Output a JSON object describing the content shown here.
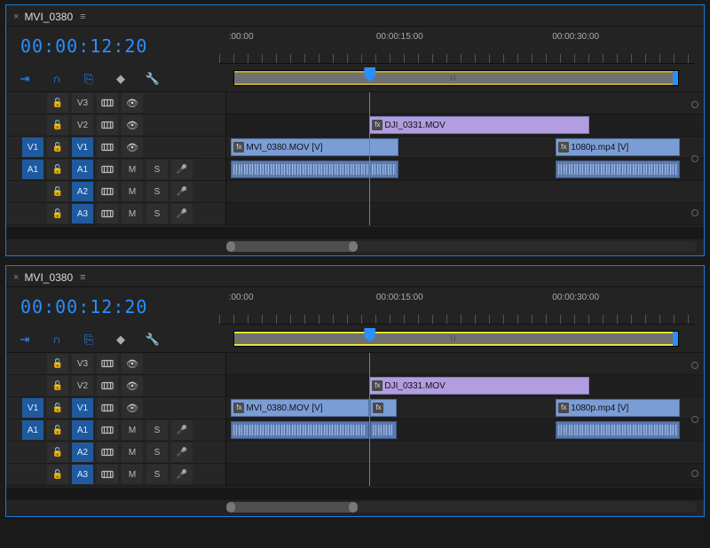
{
  "panels": [
    {
      "tab": "MVI_0380",
      "timecode": "00:00:12:20",
      "ruler_ticks": [
        ":00:00",
        "00:00:15:00",
        "00:00:30:00"
      ],
      "tracks": {
        "video": [
          {
            "name": "V3"
          },
          {
            "name": "V2"
          },
          {
            "name": "V1",
            "src": "V1"
          }
        ],
        "audio": [
          {
            "name": "A1",
            "src": "A1",
            "mute": "M",
            "solo": "S"
          },
          {
            "name": "A2",
            "mute": "M",
            "solo": "S"
          },
          {
            "name": "A3",
            "mute": "M",
            "solo": "S"
          }
        ]
      },
      "clips": {
        "v2": {
          "label": "DJI_0331.MOV"
        },
        "v1a": {
          "label": "MVI_0380.MOV [V]"
        },
        "v1b": {
          "label": "1080p.mp4 [V]"
        }
      }
    },
    {
      "tab": "MVI_0380",
      "timecode": "00:00:12:20",
      "ruler_ticks": [
        ":00:00",
        "00:00:15:00",
        "00:00:30:00"
      ],
      "tracks": {
        "video": [
          {
            "name": "V3"
          },
          {
            "name": "V2"
          },
          {
            "name": "V1",
            "src": "V1"
          }
        ],
        "audio": [
          {
            "name": "A1",
            "src": "A1",
            "mute": "M",
            "solo": "S"
          },
          {
            "name": "A2",
            "mute": "M",
            "solo": "S"
          },
          {
            "name": "A3",
            "mute": "M",
            "solo": "S"
          }
        ]
      },
      "clips": {
        "v2": {
          "label": "DJI_0331.MOV"
        },
        "v1a": {
          "label": "MVI_0380.MOV [V]"
        },
        "v1b": {
          "label": "1080p.mp4 [V]"
        }
      }
    }
  ],
  "colors": {
    "accent": "#2a8fff",
    "clip_video": "#7b9dd6",
    "clip_purple": "#b29de0",
    "clip_audio": "#5a7bb0"
  }
}
